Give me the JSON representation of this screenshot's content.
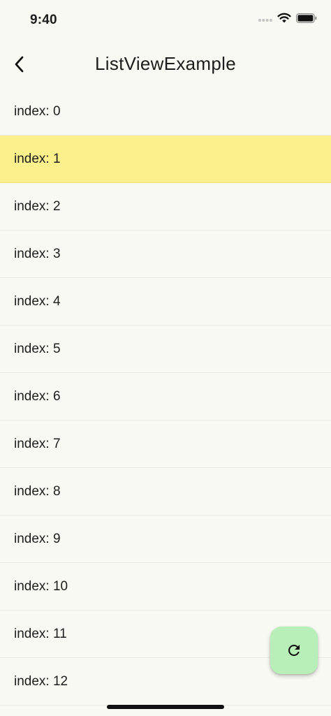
{
  "status": {
    "time": "9:40",
    "icons": [
      "signal-dots-icon",
      "wifi-icon",
      "battery-icon"
    ]
  },
  "app_bar": {
    "title": "ListViewExample",
    "back_icon": "chevron-left-icon"
  },
  "list": {
    "items": [
      {
        "label": "index: 0"
      },
      {
        "label": "index: 1"
      },
      {
        "label": "index: 2"
      },
      {
        "label": "index: 3"
      },
      {
        "label": "index: 4"
      },
      {
        "label": "index: 5"
      },
      {
        "label": "index: 6"
      },
      {
        "label": "index: 7"
      },
      {
        "label": "index: 8"
      },
      {
        "label": "index: 9"
      },
      {
        "label": "index: 10"
      },
      {
        "label": "index: 11"
      },
      {
        "label": "index: 12"
      }
    ],
    "selected_index": 1
  },
  "fab": {
    "icon": "refresh-icon"
  },
  "colors": {
    "background": "#f9f9f3",
    "selected_row": "#fbf08c",
    "fab": "#b8efb8"
  }
}
